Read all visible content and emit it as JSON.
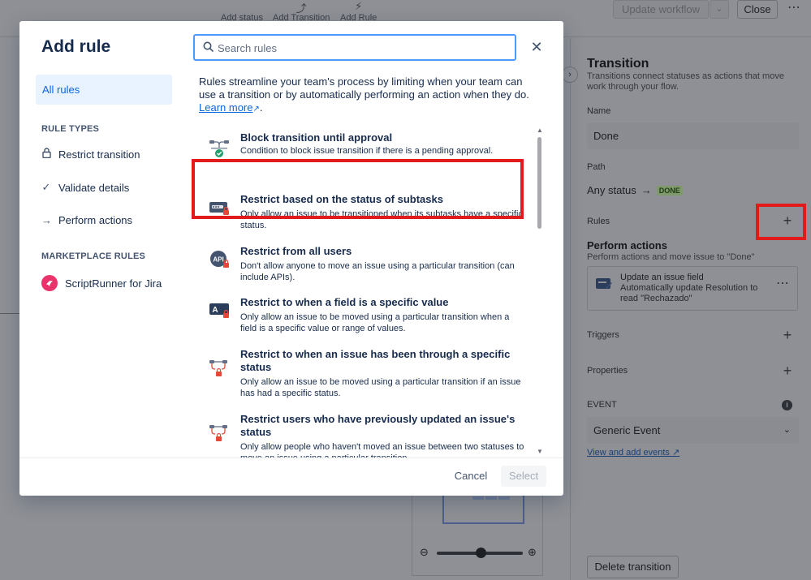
{
  "toolbar": {
    "add_status": "Add status",
    "add_transition": "Add Transition",
    "add_rule": "Add Rule",
    "update_workflow": "Update workflow",
    "close": "Close"
  },
  "panel": {
    "title": "Transition",
    "subtitle": "Transitions connect statuses as actions that move work through your flow.",
    "name_label": "Name",
    "name_value": "Done",
    "path_label": "Path",
    "path_from": "Any status",
    "path_to": "DONE",
    "rules_label": "Rules",
    "perform_title": "Perform actions",
    "perform_sub": "Perform actions and move issue to \"Done\"",
    "card_title": "Update an issue field",
    "card_desc": "Automatically update Resolution to read \"Rechazado\"",
    "triggers_label": "Triggers",
    "properties_label": "Properties",
    "event_label": "EVENT",
    "event_value": "Generic Event",
    "event_link": "View and add events",
    "delete_label": "Delete transition"
  },
  "modal": {
    "title": "Add rule",
    "search_placeholder": "Search rules",
    "intro": "Rules streamline your team's process by limiting when your team can use a transition or by automatically performing an action when they do.",
    "learn_more": "Learn more",
    "nav": {
      "all_rules": "All rules",
      "rule_types_heading": "RULE TYPES",
      "restrict": "Restrict transition",
      "validate": "Validate details",
      "perform": "Perform actions",
      "marketplace_heading": "MARKETPLACE RULES",
      "scriptrunner": "ScriptRunner for Jira"
    },
    "rules": [
      {
        "title": "Block transition until approval",
        "desc": "Condition to block issue transition if there is a pending approval.",
        "icon": "approval-icon"
      },
      {
        "title": "Restrict based on the status of subtasks",
        "desc": "Only allow an issue to be transitioned when its subtasks have a specific status.",
        "icon": "subtasks-icon"
      },
      {
        "title": "Restrict from all users",
        "desc": "Don't allow anyone to move an issue using a particular transition (can include APIs).",
        "icon": "api-icon"
      },
      {
        "title": "Restrict to when a field is a specific value",
        "desc": "Only allow an issue to be moved using a particular transition when a field is a specific value or range of values.",
        "icon": "field-icon"
      },
      {
        "title": "Restrict to when an issue has been through a specific status",
        "desc": "Only allow an issue to be moved using a particular transition if an issue has had a specific status.",
        "icon": "status-history-icon"
      },
      {
        "title": "Restrict users who have previously updated an issue's status",
        "desc": "Only allow people who haven't moved an issue between two statuses to move an issue using a particular transition.",
        "icon": "users-history-icon"
      }
    ],
    "cancel": "Cancel",
    "select": "Select"
  },
  "colors": {
    "highlight": "#e11b1b",
    "link": "#0c66e4",
    "selected_nav_bg": "#e9f2ff",
    "done_badge": "#7e9a6a"
  }
}
